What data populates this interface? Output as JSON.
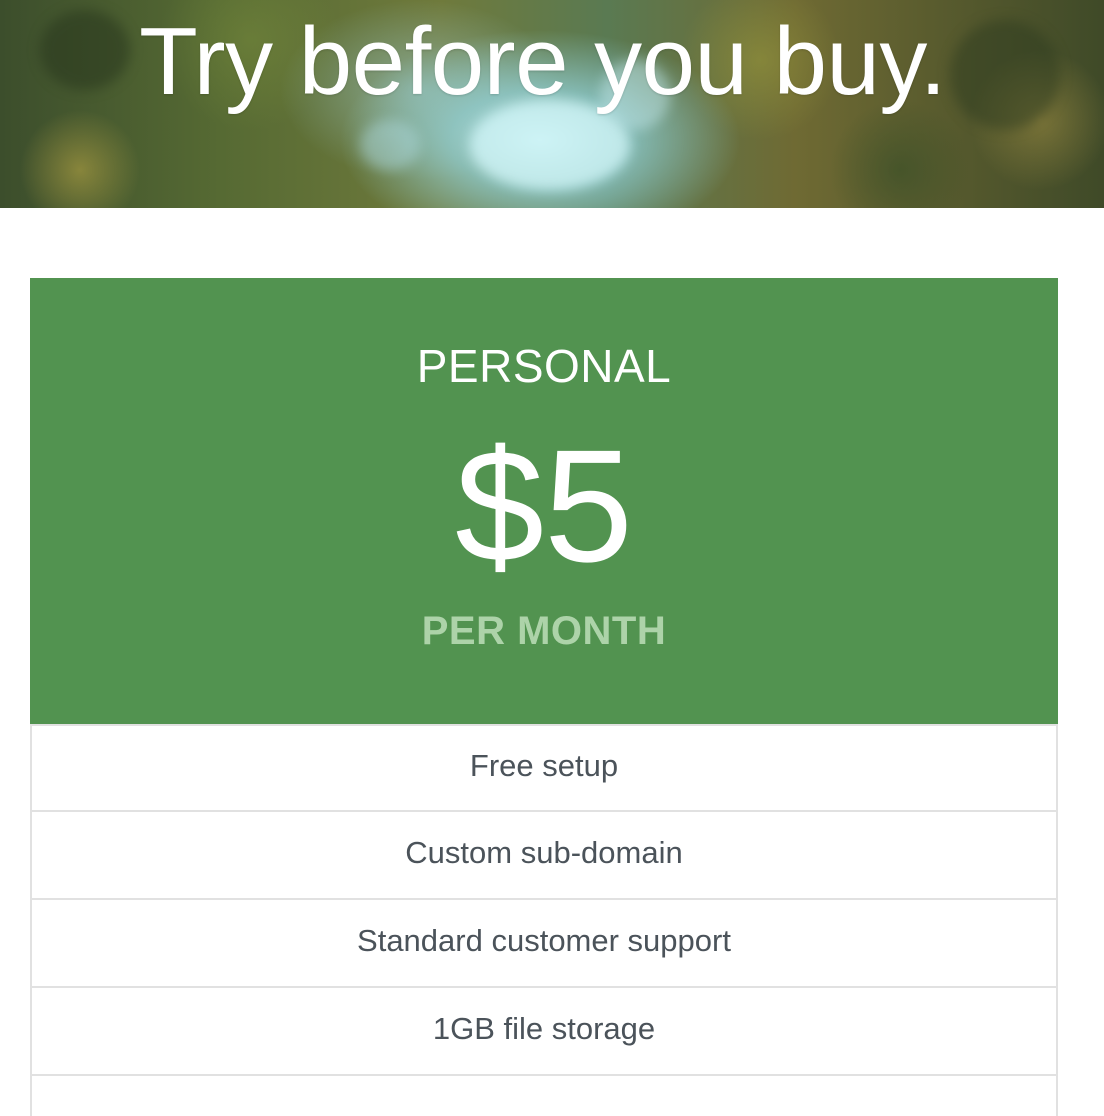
{
  "hero": {
    "title": "Try before you buy."
  },
  "plan": {
    "name": "PERSONAL",
    "price": "$5",
    "period": "PER MONTH",
    "accent_color": "#529350",
    "period_color": "#add3a9"
  },
  "features": [
    "Free setup",
    "Custom sub-domain",
    "Standard customer support",
    "1GB file storage"
  ]
}
